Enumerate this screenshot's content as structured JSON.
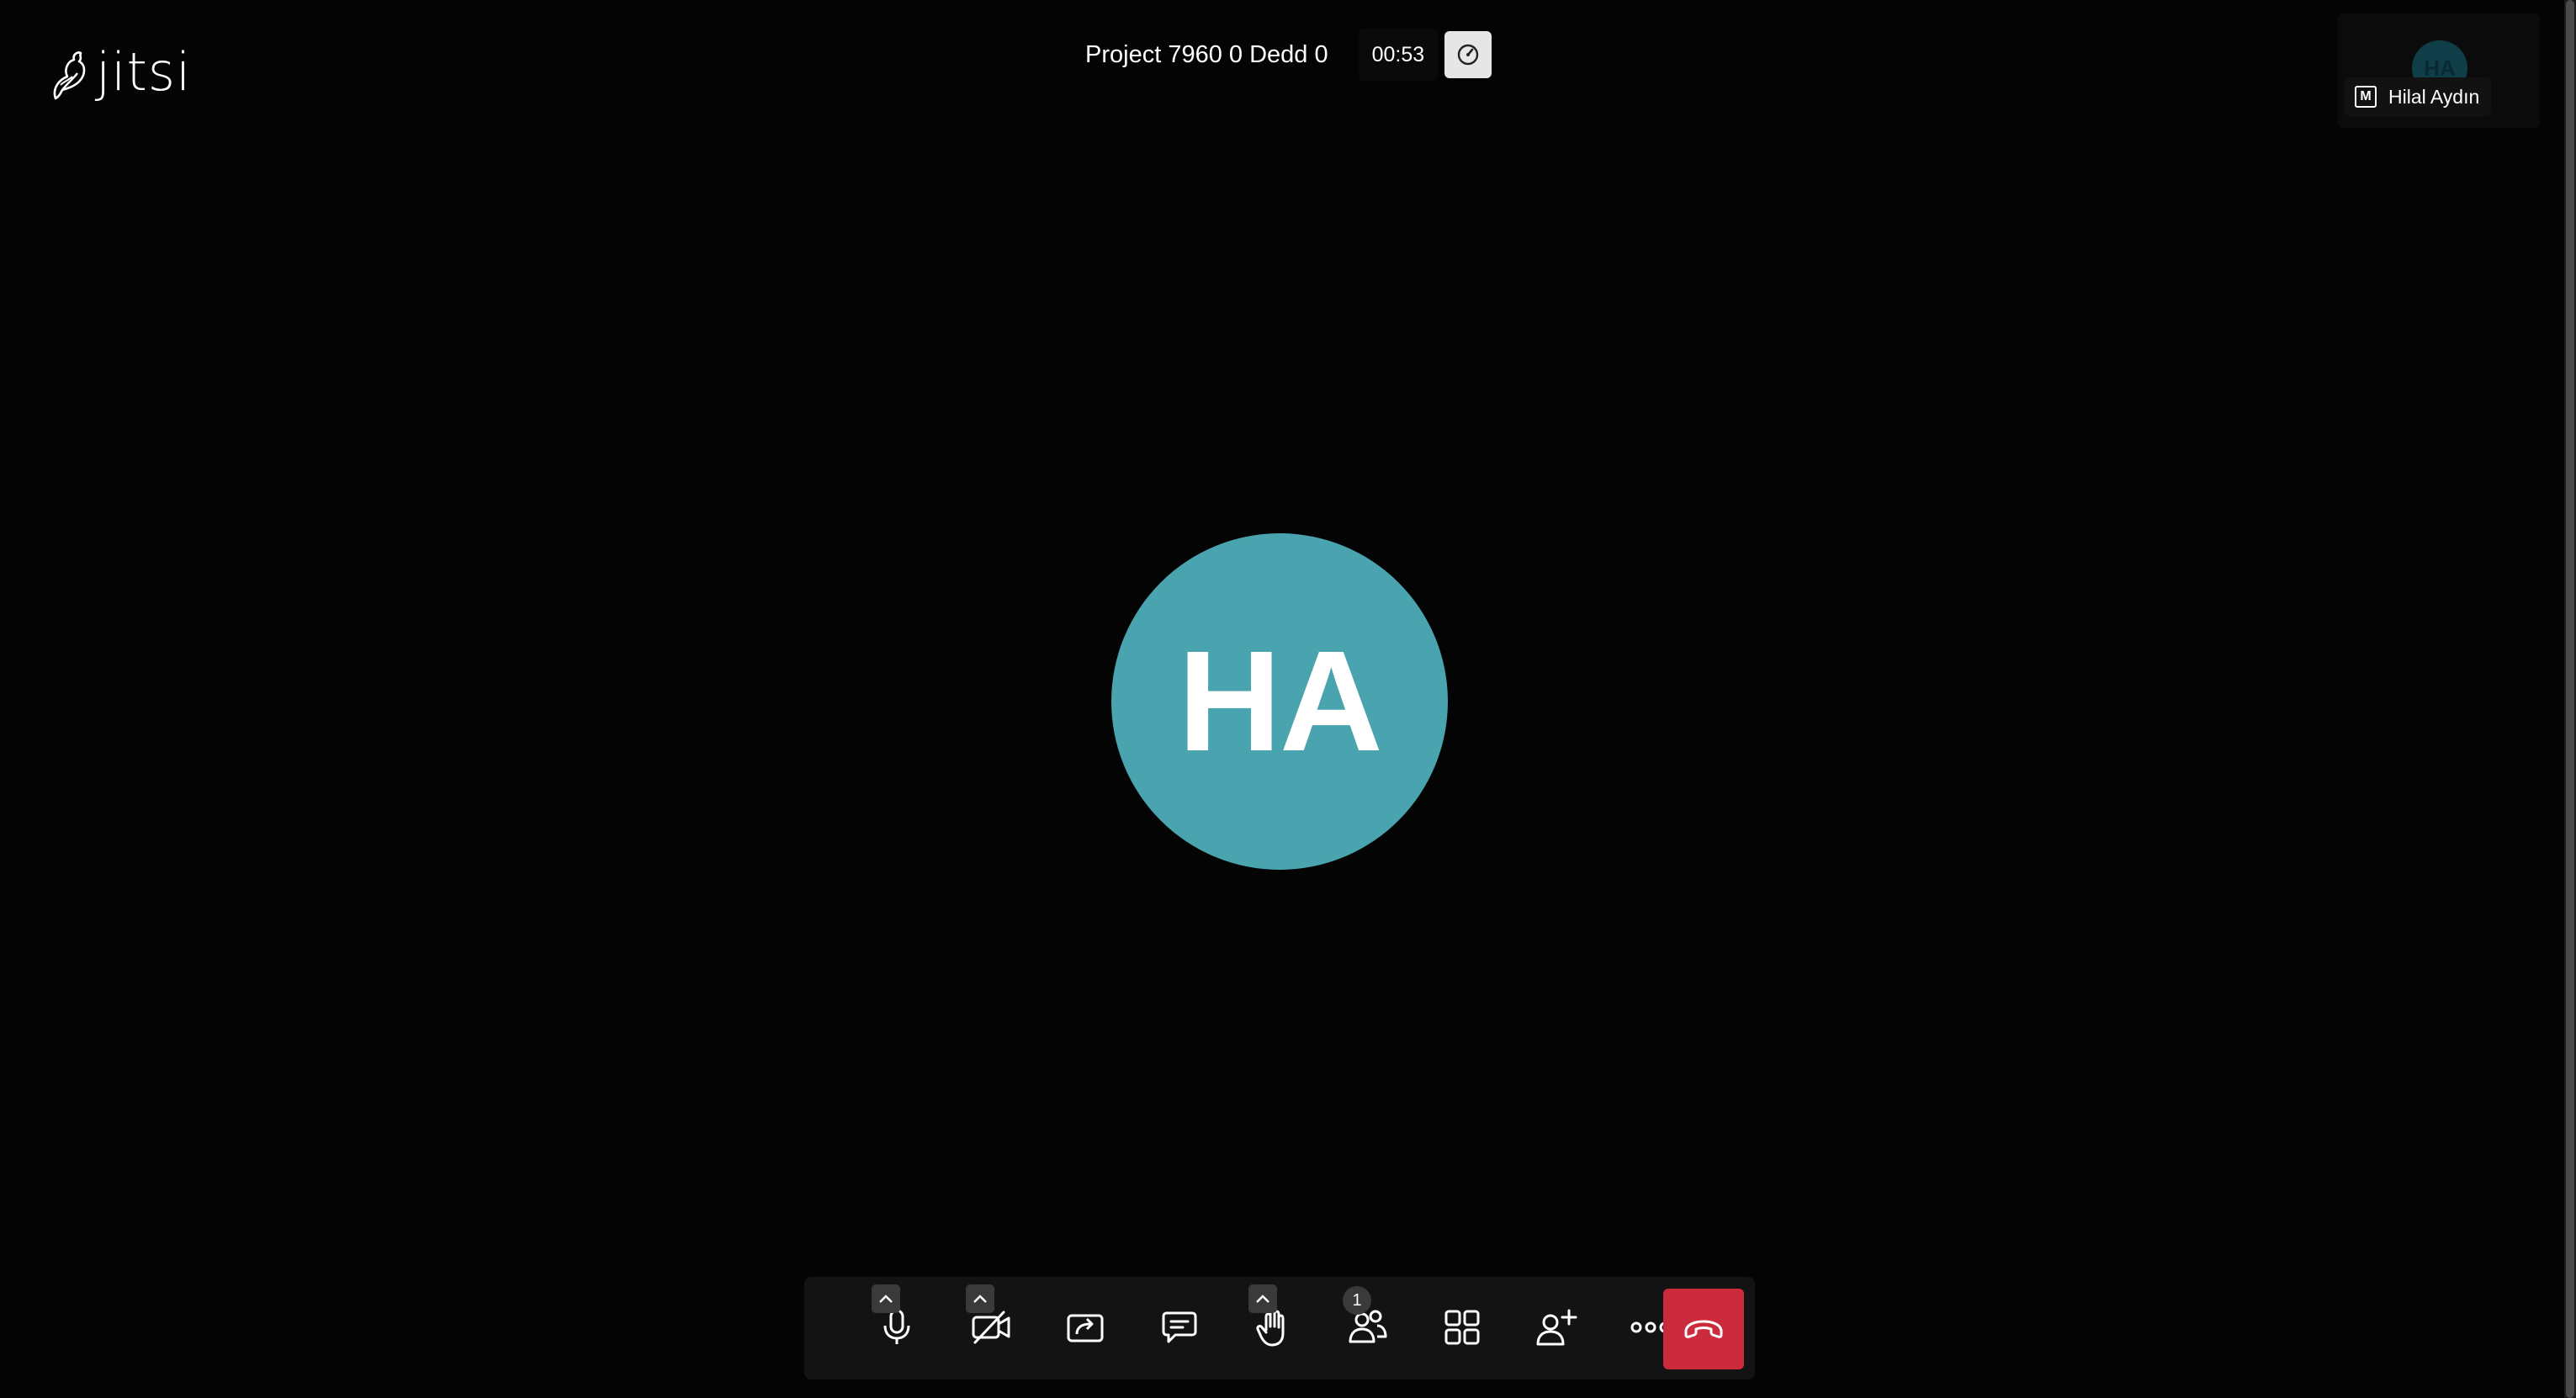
{
  "app": {
    "logo_text": "jitsi"
  },
  "conference": {
    "subject": "Project 7960 0 Dedd 0",
    "timer": "00:53"
  },
  "thumbnail": {
    "initials": "HA",
    "display_name": "Hilal Aydın",
    "moderator_badge": "M"
  },
  "main_participant": {
    "initials": "HA",
    "avatar_color": "#4aa4b0"
  },
  "toolbar": {
    "participants_count": "1",
    "buttons": [
      {
        "name": "microphone",
        "icon": "microphone-icon",
        "has_options": true
      },
      {
        "name": "camera",
        "icon": "camera-off-icon",
        "has_options": true
      },
      {
        "name": "share-screen",
        "icon": "share-screen-icon",
        "has_options": false
      },
      {
        "name": "chat",
        "icon": "chat-icon",
        "has_options": false
      },
      {
        "name": "raise-hand",
        "icon": "hand-icon",
        "has_options": true
      },
      {
        "name": "participants",
        "icon": "participants-icon",
        "has_options": false
      },
      {
        "name": "tile-view",
        "icon": "tile-view-icon",
        "has_options": false
      },
      {
        "name": "invite",
        "icon": "add-person-icon",
        "has_options": false
      },
      {
        "name": "more-actions",
        "icon": "more-icon",
        "has_options": false
      },
      {
        "name": "leave",
        "icon": "hangup-icon",
        "has_options": false
      }
    ],
    "hangup_color": "#cb2b3c"
  }
}
